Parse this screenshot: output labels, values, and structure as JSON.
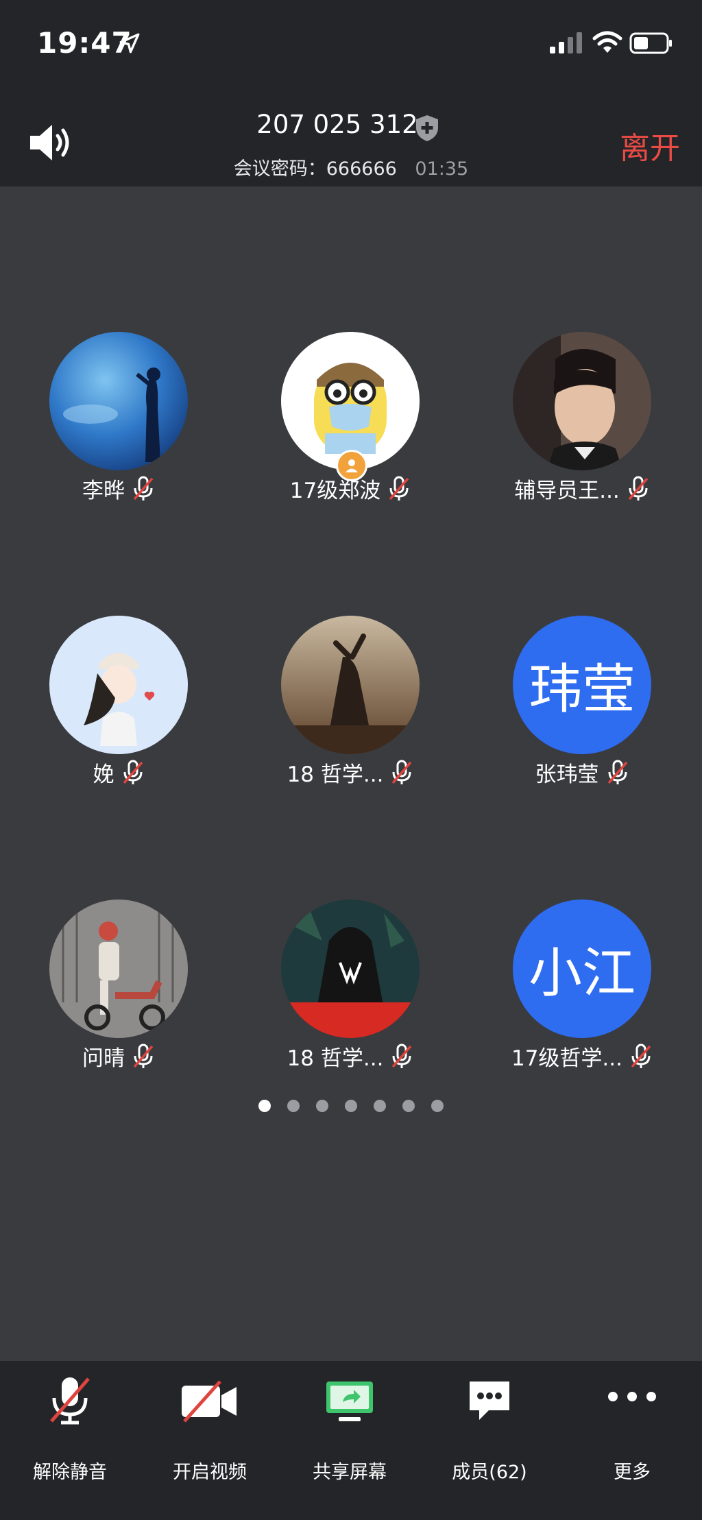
{
  "status_bar": {
    "time": "19:47"
  },
  "header": {
    "meeting_id": "207 025 312",
    "password_label": "会议密码：666666",
    "duration": "01:35",
    "leave_label": "离开"
  },
  "participants": [
    {
      "name": "李晔",
      "avatar_type": "photo-aquarium"
    },
    {
      "name": "17级郑波",
      "avatar_type": "cartoon-masked",
      "host": true
    },
    {
      "name": "辅导员王...",
      "avatar_type": "photo-portrait"
    },
    {
      "name": "娩",
      "avatar_type": "illustration-girl"
    },
    {
      "name": "18 哲学...",
      "avatar_type": "painting-figure"
    },
    {
      "name": "张玮莹",
      "avatar_type": "text",
      "avatar_text": "玮莹"
    },
    {
      "name": "问晴",
      "avatar_type": "photo-scooter"
    },
    {
      "name": "18 哲学...",
      "avatar_type": "photo-hoodie"
    },
    {
      "name": "17级哲学...",
      "avatar_type": "text",
      "avatar_text": "小江"
    }
  ],
  "pager": {
    "count": 7,
    "active_index": 0
  },
  "toolbar": {
    "unmute": "解除静音",
    "start_video": "开启视频",
    "share_screen": "共享屏幕",
    "members": "成员(62)",
    "more": "更多"
  },
  "colors": {
    "leave": "#ea4b45",
    "text_avatar": "#2e6cf0",
    "share_icon": "#3ec46d",
    "muted_slash": "#e0443f"
  }
}
